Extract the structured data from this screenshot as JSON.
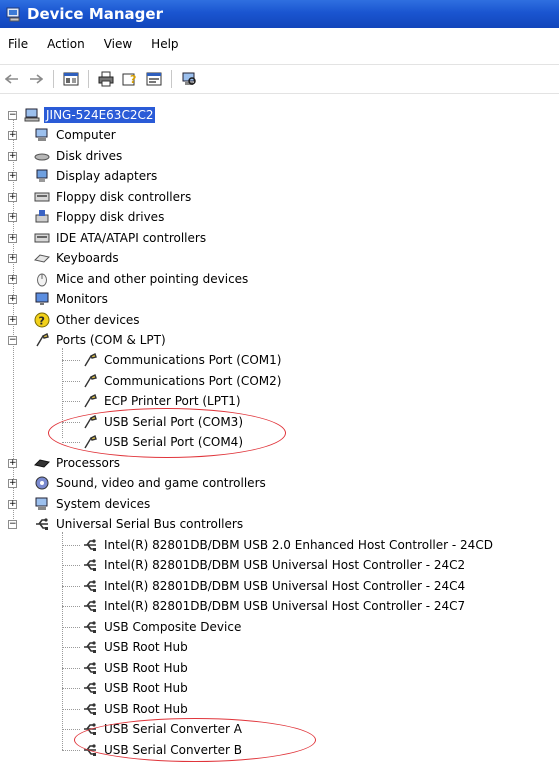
{
  "window": {
    "title": "Device Manager"
  },
  "menu": [
    "File",
    "Action",
    "View",
    "Help"
  ],
  "tree": {
    "root": "JING-524E63C2C2",
    "categories": [
      {
        "label": "Computer",
        "icon": "computer-icon"
      },
      {
        "label": "Disk drives",
        "icon": "disk-drive-icon"
      },
      {
        "label": "Display adapters",
        "icon": "display-adapter-icon"
      },
      {
        "label": "Floppy disk controllers",
        "icon": "controller-icon"
      },
      {
        "label": "Floppy disk drives",
        "icon": "floppy-drive-icon"
      },
      {
        "label": "IDE ATA/ATAPI controllers",
        "icon": "controller-icon"
      },
      {
        "label": "Keyboards",
        "icon": "keyboard-icon"
      },
      {
        "label": "Mice and other pointing devices",
        "icon": "mouse-icon"
      },
      {
        "label": "Monitors",
        "icon": "monitor-icon"
      },
      {
        "label": "Other devices",
        "icon": "unknown-device-icon"
      },
      {
        "label": "Ports (COM & LPT)",
        "icon": "port-icon"
      },
      {
        "label": "Processors",
        "icon": "processor-icon"
      },
      {
        "label": "Sound, video and game controllers",
        "icon": "sound-icon"
      },
      {
        "label": "System devices",
        "icon": "system-devices-icon"
      },
      {
        "label": "Universal Serial Bus controllers",
        "icon": "usb-icon"
      }
    ],
    "ports": [
      "Communications Port (COM1)",
      "Communications Port (COM2)",
      "ECP Printer Port (LPT1)",
      "USB Serial Port (COM3)",
      "USB Serial Port (COM4)"
    ],
    "usb": [
      "Intel(R) 82801DB/DBM USB 2.0 Enhanced Host Controller - 24CD",
      "Intel(R) 82801DB/DBM USB Universal Host Controller - 24C2",
      "Intel(R) 82801DB/DBM USB Universal Host Controller - 24C4",
      "Intel(R) 82801DB/DBM USB Universal Host Controller - 24C7",
      "USB Composite Device",
      "USB Root Hub",
      "USB Root Hub",
      "USB Root Hub",
      "USB Root Hub",
      "USB Serial Converter A",
      "USB Serial Converter B"
    ]
  },
  "colors": {
    "title_bar": "#1a55d0",
    "selection": "#2a5bd7",
    "highlight_ellipse": "#e0353b"
  }
}
